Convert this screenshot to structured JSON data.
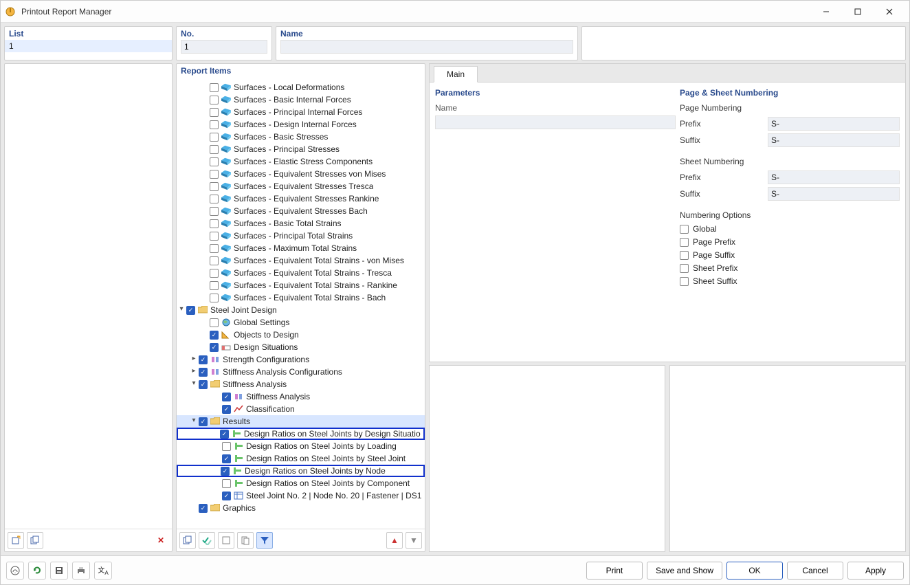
{
  "window": {
    "title": "Printout Report Manager"
  },
  "top": {
    "list_label": "List",
    "no_label": "No.",
    "name_label": "Name",
    "list_value": "1",
    "no_value": "1",
    "name_value": ""
  },
  "tree": {
    "head": "Report Items",
    "surfaces": [
      "Surfaces - Local Deformations",
      "Surfaces - Basic Internal Forces",
      "Surfaces - Principal Internal Forces",
      "Surfaces - Design Internal Forces",
      "Surfaces - Basic Stresses",
      "Surfaces - Principal Stresses",
      "Surfaces - Elastic Stress Components",
      "Surfaces - Equivalent Stresses von Mises",
      "Surfaces - Equivalent Stresses Tresca",
      "Surfaces - Equivalent Stresses Rankine",
      "Surfaces - Equivalent Stresses Bach",
      "Surfaces - Basic Total Strains",
      "Surfaces - Principal Total Strains",
      "Surfaces - Maximum Total Strains",
      "Surfaces - Equivalent Total Strains - von Mises",
      "Surfaces - Equivalent Total Strains - Tresca",
      "Surfaces - Equivalent Total Strains - Rankine",
      "Surfaces - Equivalent Total Strains - Bach"
    ],
    "sjd": {
      "label": "Steel Joint Design",
      "global_settings": "Global Settings",
      "objects_to_design": "Objects to Design",
      "design_situations": "Design Situations",
      "strength_configs": "Strength Configurations",
      "stiffness_configs": "Stiffness Analysis Configurations",
      "stiffness_analysis_parent": "Stiffness Analysis",
      "stiffness_analysis": "Stiffness Analysis",
      "classification": "Classification",
      "results": "Results",
      "r_design_situation": "Design Ratios on Steel Joints by Design Situation",
      "r_loading": "Design Ratios on Steel Joints by Loading",
      "r_steel_joint": "Design Ratios on Steel Joints by Steel Joint",
      "r_node": "Design Ratios on Steel Joints by Node",
      "r_component": "Design Ratios on Steel Joints by Component",
      "r_detail": "Steel Joint No. 2 | Node No. 20 | Fastener | DS1"
    },
    "graphics": "Graphics"
  },
  "right": {
    "tab_main": "Main",
    "parameters": "Parameters",
    "param_name": "Name",
    "page_sheet": "Page & Sheet Numbering",
    "page_numbering": "Page Numbering",
    "sheet_numbering": "Sheet Numbering",
    "prefix": "Prefix",
    "suffix": "Suffix",
    "prefix_val": "S-",
    "suffix_val": "S-",
    "numbering_options": "Numbering Options",
    "opt_global": "Global",
    "opt_page_prefix": "Page Prefix",
    "opt_page_suffix": "Page Suffix",
    "opt_sheet_prefix": "Sheet Prefix",
    "opt_sheet_suffix": "Sheet Suffix"
  },
  "footer": {
    "print": "Print",
    "save_show": "Save and Show",
    "ok": "OK",
    "cancel": "Cancel",
    "apply": "Apply"
  }
}
